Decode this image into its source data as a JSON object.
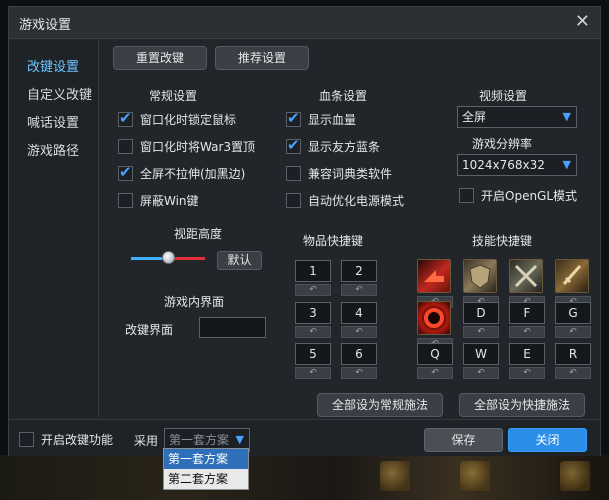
{
  "window": {
    "title": "游戏设置",
    "close_glyph": "✕"
  },
  "sidebar": {
    "items": [
      {
        "label": "改键设置",
        "active": true
      },
      {
        "label": "自定义改键",
        "active": false
      },
      {
        "label": "喊话设置",
        "active": false
      },
      {
        "label": "游戏路径",
        "active": false
      }
    ]
  },
  "toolbar": {
    "reset_label": "重置改键",
    "recommend_label": "推荐设置"
  },
  "general": {
    "title": "常规设置",
    "options": [
      {
        "label": "窗口化时锁定鼠标",
        "checked": true
      },
      {
        "label": "窗口化时将War3置顶",
        "checked": false
      },
      {
        "label": "全屏不拉伸(加黑边)",
        "checked": true
      },
      {
        "label": "屏蔽Win键",
        "checked": false
      }
    ]
  },
  "healthbar": {
    "title": "血条设置",
    "options": [
      {
        "label": "显示血量",
        "checked": true
      },
      {
        "label": "显示友方蓝条",
        "checked": true
      },
      {
        "label": "兼容词典类软件",
        "checked": false
      },
      {
        "label": "自动优化电源模式",
        "checked": false
      }
    ]
  },
  "video": {
    "title": "视频设置",
    "mode_value": "全屏",
    "resolution_title": "游戏分辨率",
    "resolution_value": "1024x768x32",
    "opengl_label": "开启OpenGL模式",
    "opengl_checked": false,
    "dropdown_glyph": "▼"
  },
  "view": {
    "title": "视距高度",
    "level": 0.5,
    "default_label": "默认"
  },
  "ui": {
    "title": "游戏内界面",
    "rebind_label": "改键界面",
    "rebind_value": ""
  },
  "items": {
    "title": "物品快捷键",
    "keys": [
      "1",
      "2",
      "3",
      "4",
      "5",
      "6"
    ],
    "reset_glyph": "↶"
  },
  "skills": {
    "title": "技能快捷键",
    "icons": [
      "red-arrow-skill-icon",
      "shield-skill-icon",
      "crossed-swords-skill-icon",
      "sword-skill-icon",
      "red-vortex-skill-icon"
    ],
    "keys": [
      "D",
      "F",
      "G",
      "Q",
      "W",
      "E",
      "R"
    ],
    "reset_glyph": "↶"
  },
  "actions": {
    "normal_label": "全部设为常规施法",
    "quick_label": "全部设为快捷施法"
  },
  "footer": {
    "enable_label": "开启改键功能",
    "enable_checked": false,
    "use_label": "采用",
    "plan_value": "第一套方案",
    "plan_options": [
      "第一套方案",
      "第二套方案"
    ],
    "save_label": "保存",
    "close_label": "关闭"
  },
  "colors": {
    "accent": "#2b8ee8",
    "check": "#4aa3ff",
    "slider_left": "#3bb0ff",
    "slider_right": "#e0303a"
  }
}
